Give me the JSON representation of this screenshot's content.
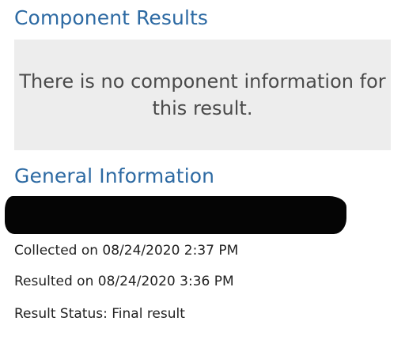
{
  "component_results": {
    "title": "Component Results",
    "empty_message": "There is no component information for this result."
  },
  "general_information": {
    "title": "General Information",
    "collected": "Collected on 08/24/2020 2:37 PM",
    "resulted": "Resulted on 08/24/2020 3:36 PM",
    "status": "Result Status: Final result"
  },
  "colors": {
    "heading": "#2d6aa3",
    "panel_background": "#ededed",
    "redaction": "#050505"
  }
}
